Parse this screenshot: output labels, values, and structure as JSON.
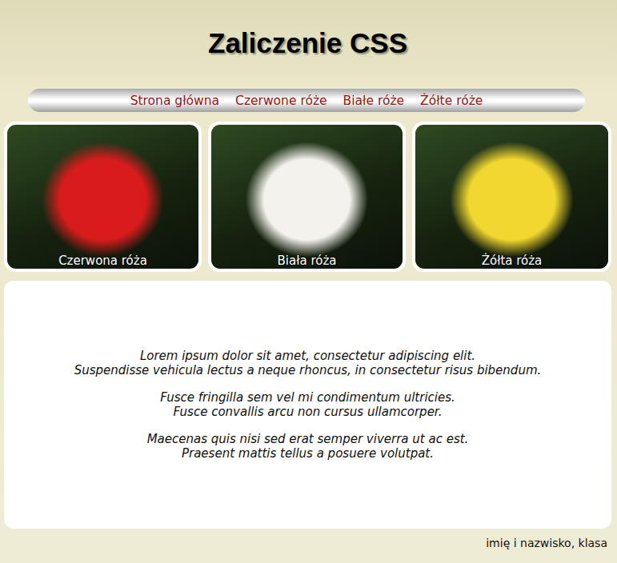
{
  "header": {
    "title": "Zaliczenie CSS"
  },
  "nav": {
    "items": [
      {
        "label": "Strona główna"
      },
      {
        "label": "Czerwone róże"
      },
      {
        "label": "Białe róże"
      },
      {
        "label": "Żółte róże"
      }
    ]
  },
  "gallery": [
    {
      "caption": "Czerwona róża",
      "color": "#d81c1c"
    },
    {
      "caption": "Biała róża",
      "color": "#f4f2ec"
    },
    {
      "caption": "Żółta róża",
      "color": "#f2d730"
    }
  ],
  "content": {
    "paragraphs": [
      [
        "Lorem ipsum dolor sit amet, consectetur adipiscing elit.",
        "Suspendisse vehicula lectus a neque rhoncus, in consectetur risus bibendum."
      ],
      [
        "Fusce fringilla sem vel mi condimentum ultricies.",
        "Fusce convallis arcu non cursus ullamcorper."
      ],
      [
        "Maecenas quis nisi sed erat semper viverra ut ac est.",
        "Praesent mattis tellus a posuere volutpat."
      ]
    ]
  },
  "footer": {
    "text": "imię i nazwisko, klasa"
  }
}
